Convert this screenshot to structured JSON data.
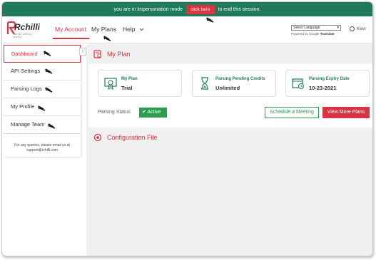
{
  "impersonation": {
    "prefix": "you are in Impersonation mode",
    "button": "click here",
    "suffix": "to end this session."
  },
  "brand": {
    "logo_text": "Rchilli",
    "logo_tagline": "PARSE | MATCH | ENRICH"
  },
  "nav": {
    "items": [
      {
        "label": "My Account",
        "active": true
      },
      {
        "label": "My Plans",
        "active": false
      },
      {
        "label": "Help",
        "active": false
      }
    ]
  },
  "language": {
    "select_label": "Select Language",
    "powered_prefix": "Powered by",
    "google": "Google",
    "translate": "Translate"
  },
  "user": {
    "name": "Kavi"
  },
  "sidebar": {
    "items": [
      {
        "label": "Dashboard",
        "active": true
      },
      {
        "label": "API Settings",
        "active": false
      },
      {
        "label": "Parsing Logs",
        "active": false
      },
      {
        "label": "My Profile",
        "active": false
      },
      {
        "label": "Manage Team",
        "active": false
      }
    ],
    "help_line1": "For any queries, please email us at",
    "help_line2": "support@rchilli.com"
  },
  "my_plan": {
    "title": "My Plan",
    "cards": [
      {
        "title": "My Plan",
        "value": "Trial",
        "icon": "certificate-icon"
      },
      {
        "title": "Parsing Pending Credits",
        "value": "Unlimited",
        "icon": "hourglass-icon"
      },
      {
        "title": "Parsing Expiry Date",
        "value": "10-23-2021",
        "icon": "calendar-icon"
      }
    ],
    "status_label": "Parsing Status:",
    "status_value": "Active",
    "schedule_button": "Schedule a Meeting",
    "view_plans_button": "View More Plans"
  },
  "config": {
    "title": "Configuration File"
  },
  "colors": {
    "accent": "#d9343f",
    "green": "#1f7a5c",
    "active_green": "#2a9d4f"
  }
}
